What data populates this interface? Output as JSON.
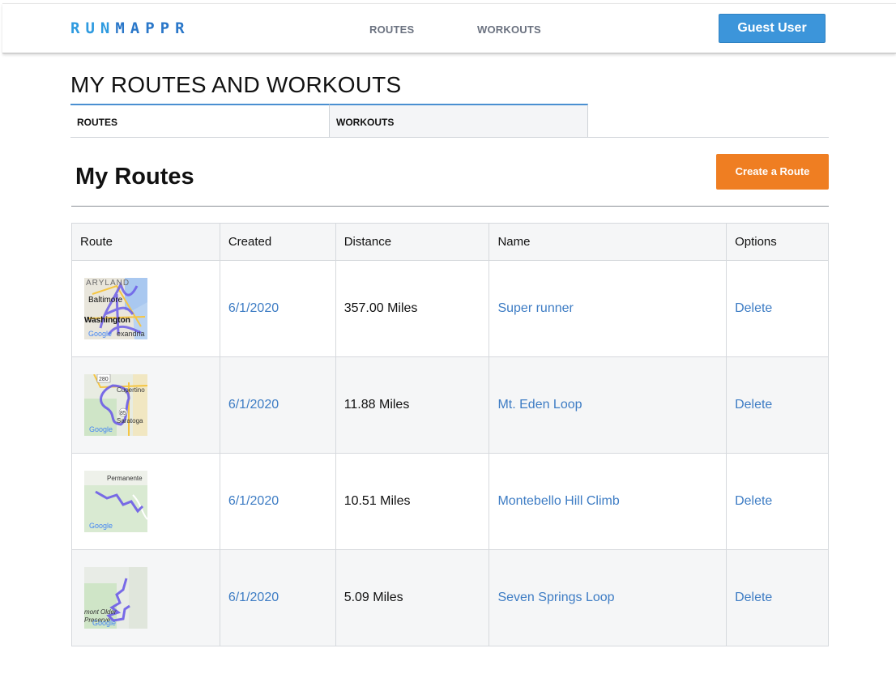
{
  "header": {
    "logo_part1": "RUN",
    "logo_part2": "MAPPR",
    "nav": {
      "routes": "ROUTES",
      "workouts": "WORKOUTS"
    },
    "user_button": "Guest User"
  },
  "page": {
    "title": "MY ROUTES AND WORKOUTS",
    "tabs": [
      {
        "label": "ROUTES"
      },
      {
        "label": "WORKOUTS"
      }
    ]
  },
  "section": {
    "title": "My Routes",
    "create_button": "Create a Route"
  },
  "table": {
    "headers": [
      "Route",
      "Created",
      "Distance",
      "Name",
      "Options"
    ],
    "rows": [
      {
        "map_labels": [
          "ARYLAND",
          "Baltimore",
          "Washington",
          "Google",
          "exandria"
        ],
        "created": "6/1/2020",
        "distance": "357.00 Miles",
        "name": "Super runner",
        "option": "Delete"
      },
      {
        "map_labels": [
          "280",
          "Cupertino",
          "85",
          "Saratoga",
          "Google"
        ],
        "created": "6/1/2020",
        "distance": "11.88 Miles",
        "name": "Mt. Eden Loop",
        "option": "Delete"
      },
      {
        "map_labels": [
          "Permanente",
          "Google"
        ],
        "created": "6/1/2020",
        "distance": "10.51 Miles",
        "name": "Montebello Hill Climb",
        "option": "Delete"
      },
      {
        "map_labels": [
          "mont Older",
          "Preserve",
          "Google"
        ],
        "created": "6/1/2020",
        "distance": "5.09 Miles",
        "name": "Seven Springs Loop",
        "option": "Delete"
      }
    ]
  },
  "colors": {
    "brand_light": "#2f9be0",
    "brand_dark": "#2a77c9",
    "user_button": "#3c95da",
    "create_button": "#ef7e22",
    "link": "#3d7cc4",
    "route_line": "#6b5ce7"
  }
}
